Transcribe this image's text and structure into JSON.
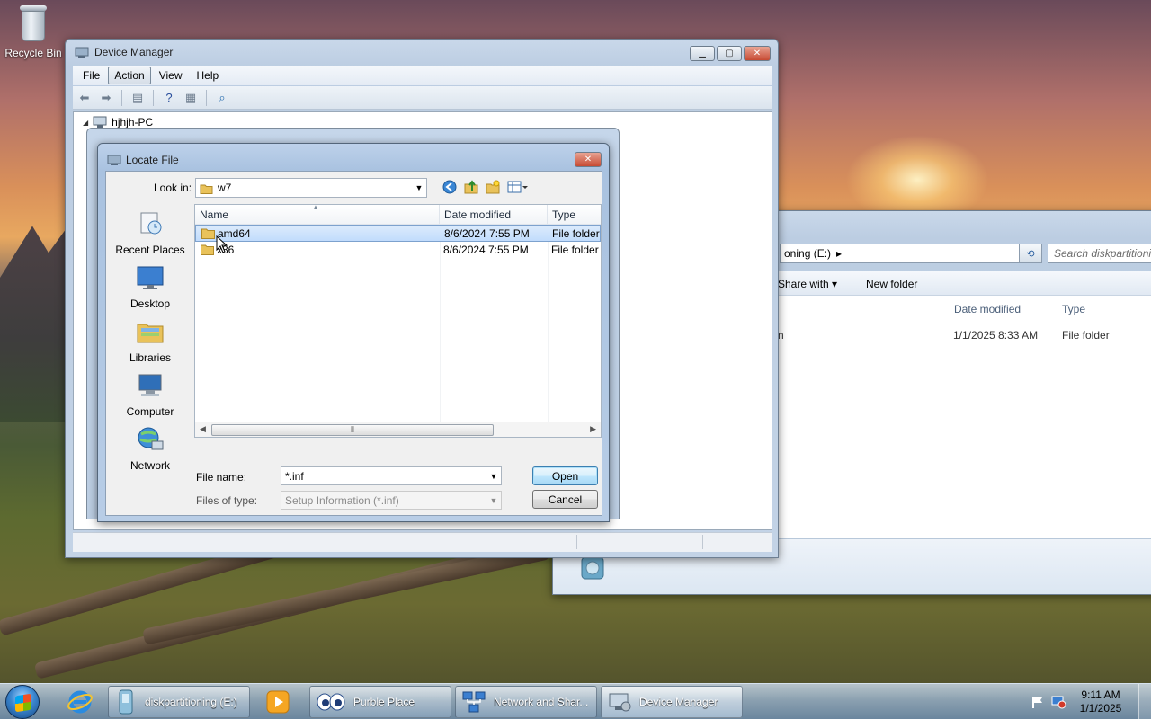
{
  "desktop": {
    "recycle_bin_label": "Recycle Bin"
  },
  "explorer": {
    "address_text": "oning (E:)",
    "address_arrow": "▸",
    "search_placeholder": "Search diskpartitioni",
    "toolbar": {
      "share_with": "Share with ▾",
      "new_folder": "New folder"
    },
    "columns": {
      "date_modified": "Date modified",
      "type": "Type"
    },
    "row": {
      "name_fragment": "n",
      "date": "1/1/2025 8:33 AM",
      "type": "File folder"
    }
  },
  "device_manager": {
    "title": "Device Manager",
    "menu": [
      "File",
      "Action",
      "View",
      "Help"
    ],
    "tree_root": "hjhjh-PC"
  },
  "locate_file": {
    "title": "Locate File",
    "look_in_label": "Look in:",
    "look_in_value": "w7",
    "places": [
      "Recent Places",
      "Desktop",
      "Libraries",
      "Computer",
      "Network"
    ],
    "columns": {
      "name": "Name",
      "date_modified": "Date modified",
      "type": "Type"
    },
    "rows": [
      {
        "name": "amd64",
        "date": "8/6/2024 7:55 PM",
        "type": "File folder",
        "selected": true
      },
      {
        "name": "x86",
        "date": "8/6/2024 7:55 PM",
        "type": "File folder",
        "selected": false
      }
    ],
    "file_name_label": "File name:",
    "file_name_value": "*.inf",
    "files_of_type_label": "Files of type:",
    "files_of_type_value": "Setup Information (*.inf)",
    "open_button": "Open",
    "cancel_button": "Cancel"
  },
  "taskbar": {
    "buttons": [
      {
        "label": "diskpartitioning (E:)",
        "icon": "usb-drive-icon"
      },
      {
        "label": "Purble Place",
        "icon": "purble-eyes-icon"
      },
      {
        "label": "Network and Shar...",
        "icon": "network-icon"
      },
      {
        "label": "Device Manager",
        "icon": "device-manager-icon",
        "active": true
      }
    ],
    "clock": {
      "time": "9:11 AM",
      "date": "1/1/2025"
    }
  },
  "colors": {
    "selection": "#c1dcfc",
    "accent": "#3c7fb1",
    "folder": "#e9c25a"
  }
}
